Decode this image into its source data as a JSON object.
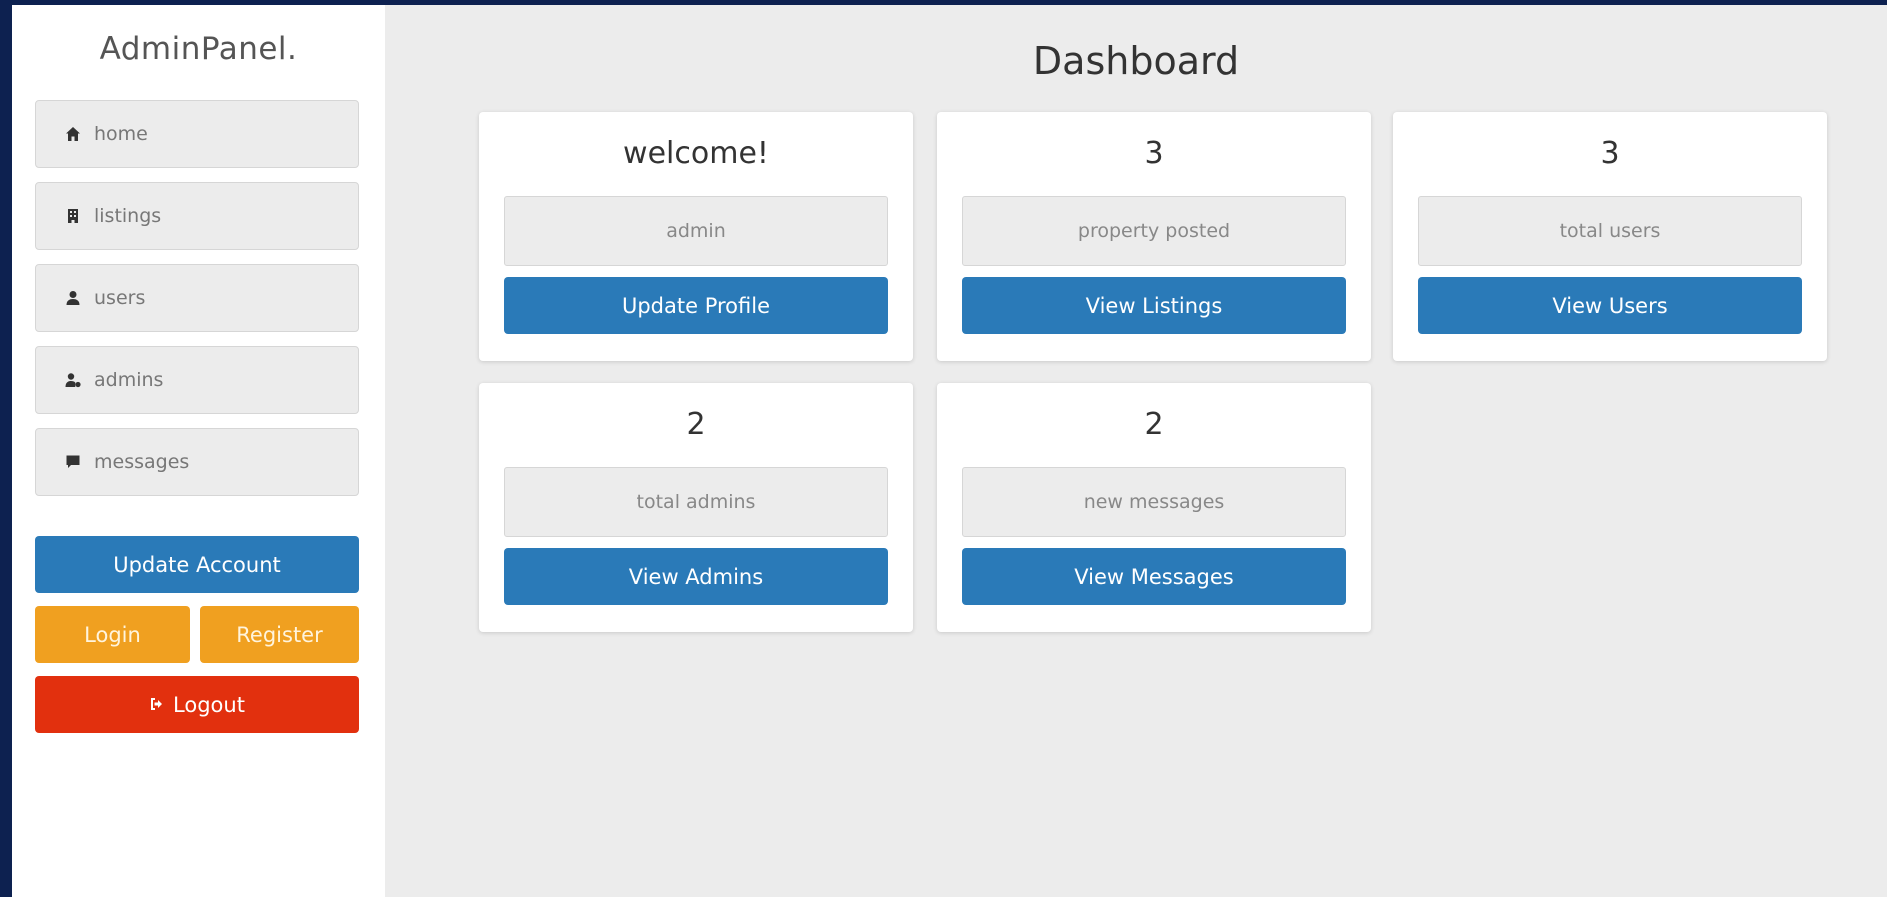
{
  "sidebar": {
    "logo": "AdminPanel.",
    "nav": [
      {
        "label": "home",
        "icon": "home-icon"
      },
      {
        "label": "listings",
        "icon": "building-icon"
      },
      {
        "label": "users",
        "icon": "user-icon"
      },
      {
        "label": "admins",
        "icon": "user-gear-icon"
      },
      {
        "label": "messages",
        "icon": "comment-icon"
      }
    ],
    "update_account": "Update Account",
    "login": "Login",
    "register": "Register",
    "logout": "Logout"
  },
  "main": {
    "title": "Dashboard",
    "cards": [
      {
        "heading": "welcome!",
        "label": "admin",
        "button": "Update Profile"
      },
      {
        "heading": "3",
        "label": "property posted",
        "button": "View Listings"
      },
      {
        "heading": "3",
        "label": "total users",
        "button": "View Users"
      },
      {
        "heading": "2",
        "label": "total admins",
        "button": "View Admins"
      },
      {
        "heading": "2",
        "label": "new messages",
        "button": "View Messages"
      }
    ]
  },
  "colors": {
    "background": "#0d2150",
    "primary": "#2a7ab8",
    "warning": "#f0a020",
    "danger": "#e2300e"
  }
}
